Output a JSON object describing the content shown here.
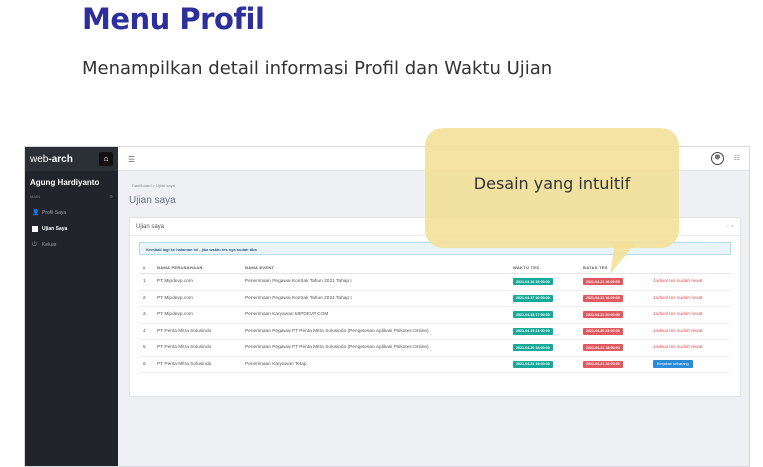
{
  "slide": {
    "title": "Menu Profil",
    "subtitle": "Menampilkan detail informasi Profil dan Waktu Ujian"
  },
  "app": {
    "brand_prefix": "web",
    "brand_suffix": "arch",
    "user_name": "Agung Hardiyanto",
    "menu_label": "MAIN",
    "nav": [
      {
        "label": "Profil Saya",
        "icon": "user-icon"
      },
      {
        "label": "Ujian Saya",
        "icon": "checkbox-icon"
      },
      {
        "label": "Keluar",
        "icon": "power-icon"
      }
    ],
    "breadcrumb": "Dashboard  >  Ujian saya",
    "page_heading": "Ujian saya",
    "card_title": "Ujian saya",
    "card_tools": "− ×",
    "alert": "Kembali lagi ke halaman ini , jika waktu tes nya sudah tiba",
    "columns": [
      "#",
      "NAMA PERUSAHAAN",
      "NAMA EVENT",
      "WAKTU TES",
      "BATAS TES",
      ""
    ],
    "rows": [
      {
        "no": "1",
        "company": "PT Mipdevp.com",
        "event": "Penerimaan Pegawai Kontrak Tahun 2021 Tahap I",
        "start": "2021-04-16 15:00:00",
        "end": "2021-04-21 16:00:00",
        "status": "Jadwal tes sudah lewat"
      },
      {
        "no": "2",
        "company": "PT Mipdevp.com",
        "event": "Penerimaan Pegawai Kontrak Tahun 2021 Tahap I",
        "start": "2021-04-17 10:00:00",
        "end": "2021-04-21 16:00:00",
        "status": "Jadwal tes sudah lewat"
      },
      {
        "no": "3",
        "company": "PT Mipdevp.com",
        "event": "Penerimaan Karyawan MIPDEVP.COM",
        "start": "2021-04-18 17:00:00",
        "end": "2021-04-21 20:00:00",
        "status": "Jadwal tes sudah lewat"
      },
      {
        "no": "4",
        "company": "PT Penta Mitra Solusindo",
        "event": "Penerimaan Pegawai PT Penta Mitra Solusindo (Pengetesan Aplikasi Psikotes Online)",
        "start": "2021-04-19 23:00:00",
        "end": "2021-04-20 23:00:00",
        "status": "Jadwal tes sudah lewat"
      },
      {
        "no": "5",
        "company": "PT Penta Mitra Solusindo",
        "event": "Penerimaan Pegawai PT Penta Mitra Solusindo (Pengetesan Aplikasi Psikotes Online)",
        "start": "2021-04-20 18:00:00",
        "end": "2021-04-21 18:00:00",
        "status": "Jadwal tes sudah lewat"
      },
      {
        "no": "6",
        "company": "PT Penta Mitra Solusindo",
        "event": "Penerimaan Karyawan Tetap",
        "start": "2021-04-21 19:00:00",
        "end": "2021-04-21 22:00:00",
        "action": "Kerjakan sekarang"
      }
    ]
  },
  "callout": {
    "text": "Desain yang intuitif"
  }
}
